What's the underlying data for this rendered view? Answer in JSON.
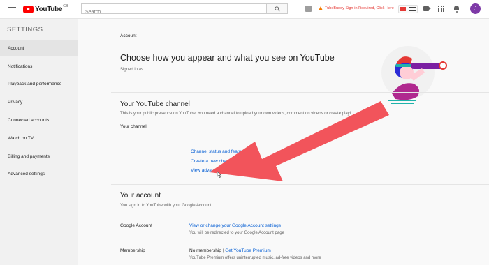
{
  "topbar": {
    "logo_text": "YouTube",
    "logo_country": "GB",
    "search_placeholder": "Search",
    "warning_text": "TubeBuddy Sign-in Required, Click Here",
    "avatar_letter": "J",
    "icons": [
      "menu-icon",
      "search-icon",
      "extension-icon",
      "warning-icon",
      "tubebuddy-icon",
      "video-camera-icon",
      "apps-icon",
      "bell-icon"
    ]
  },
  "sidebar": {
    "heading": "SETTINGS",
    "items": [
      {
        "label": "Account",
        "active": true
      },
      {
        "label": "Notifications"
      },
      {
        "label": "Playback and performance"
      },
      {
        "label": "Privacy"
      },
      {
        "label": "Connected accounts"
      },
      {
        "label": "Watch on TV"
      },
      {
        "label": "Billing and payments"
      },
      {
        "label": "Advanced settings"
      }
    ]
  },
  "main": {
    "section_label": "Account",
    "title": "Choose how you appear and what you see on YouTube",
    "signed_in": "Signed in as",
    "channel": {
      "heading": "Your YouTube channel",
      "description": "This is your public presence on YouTube. You need a channel to upload your own videos, comment on videos or create playl",
      "label": "Your channel",
      "links": [
        "Channel status and features",
        "Create a new channel",
        "View advanced settings"
      ]
    },
    "account": {
      "heading": "Your account",
      "description": "You sign in to YouTube with your Google Account",
      "google_label": "Google Account",
      "google_link": "View or change your Google Account settings",
      "google_note": "You will be redirected to your Google Account page",
      "membership_label": "Membership",
      "membership_status": "No membership",
      "membership_separator": "|",
      "membership_link": "Get YouTube Premium",
      "membership_note": "YouTube Premium offers uninterrupted music, ad-free videos and more"
    }
  },
  "colors": {
    "accent_link": "#065fd4",
    "arrow": "#f2545b",
    "warning": "#e53935",
    "avatar": "#7e3aa7"
  }
}
